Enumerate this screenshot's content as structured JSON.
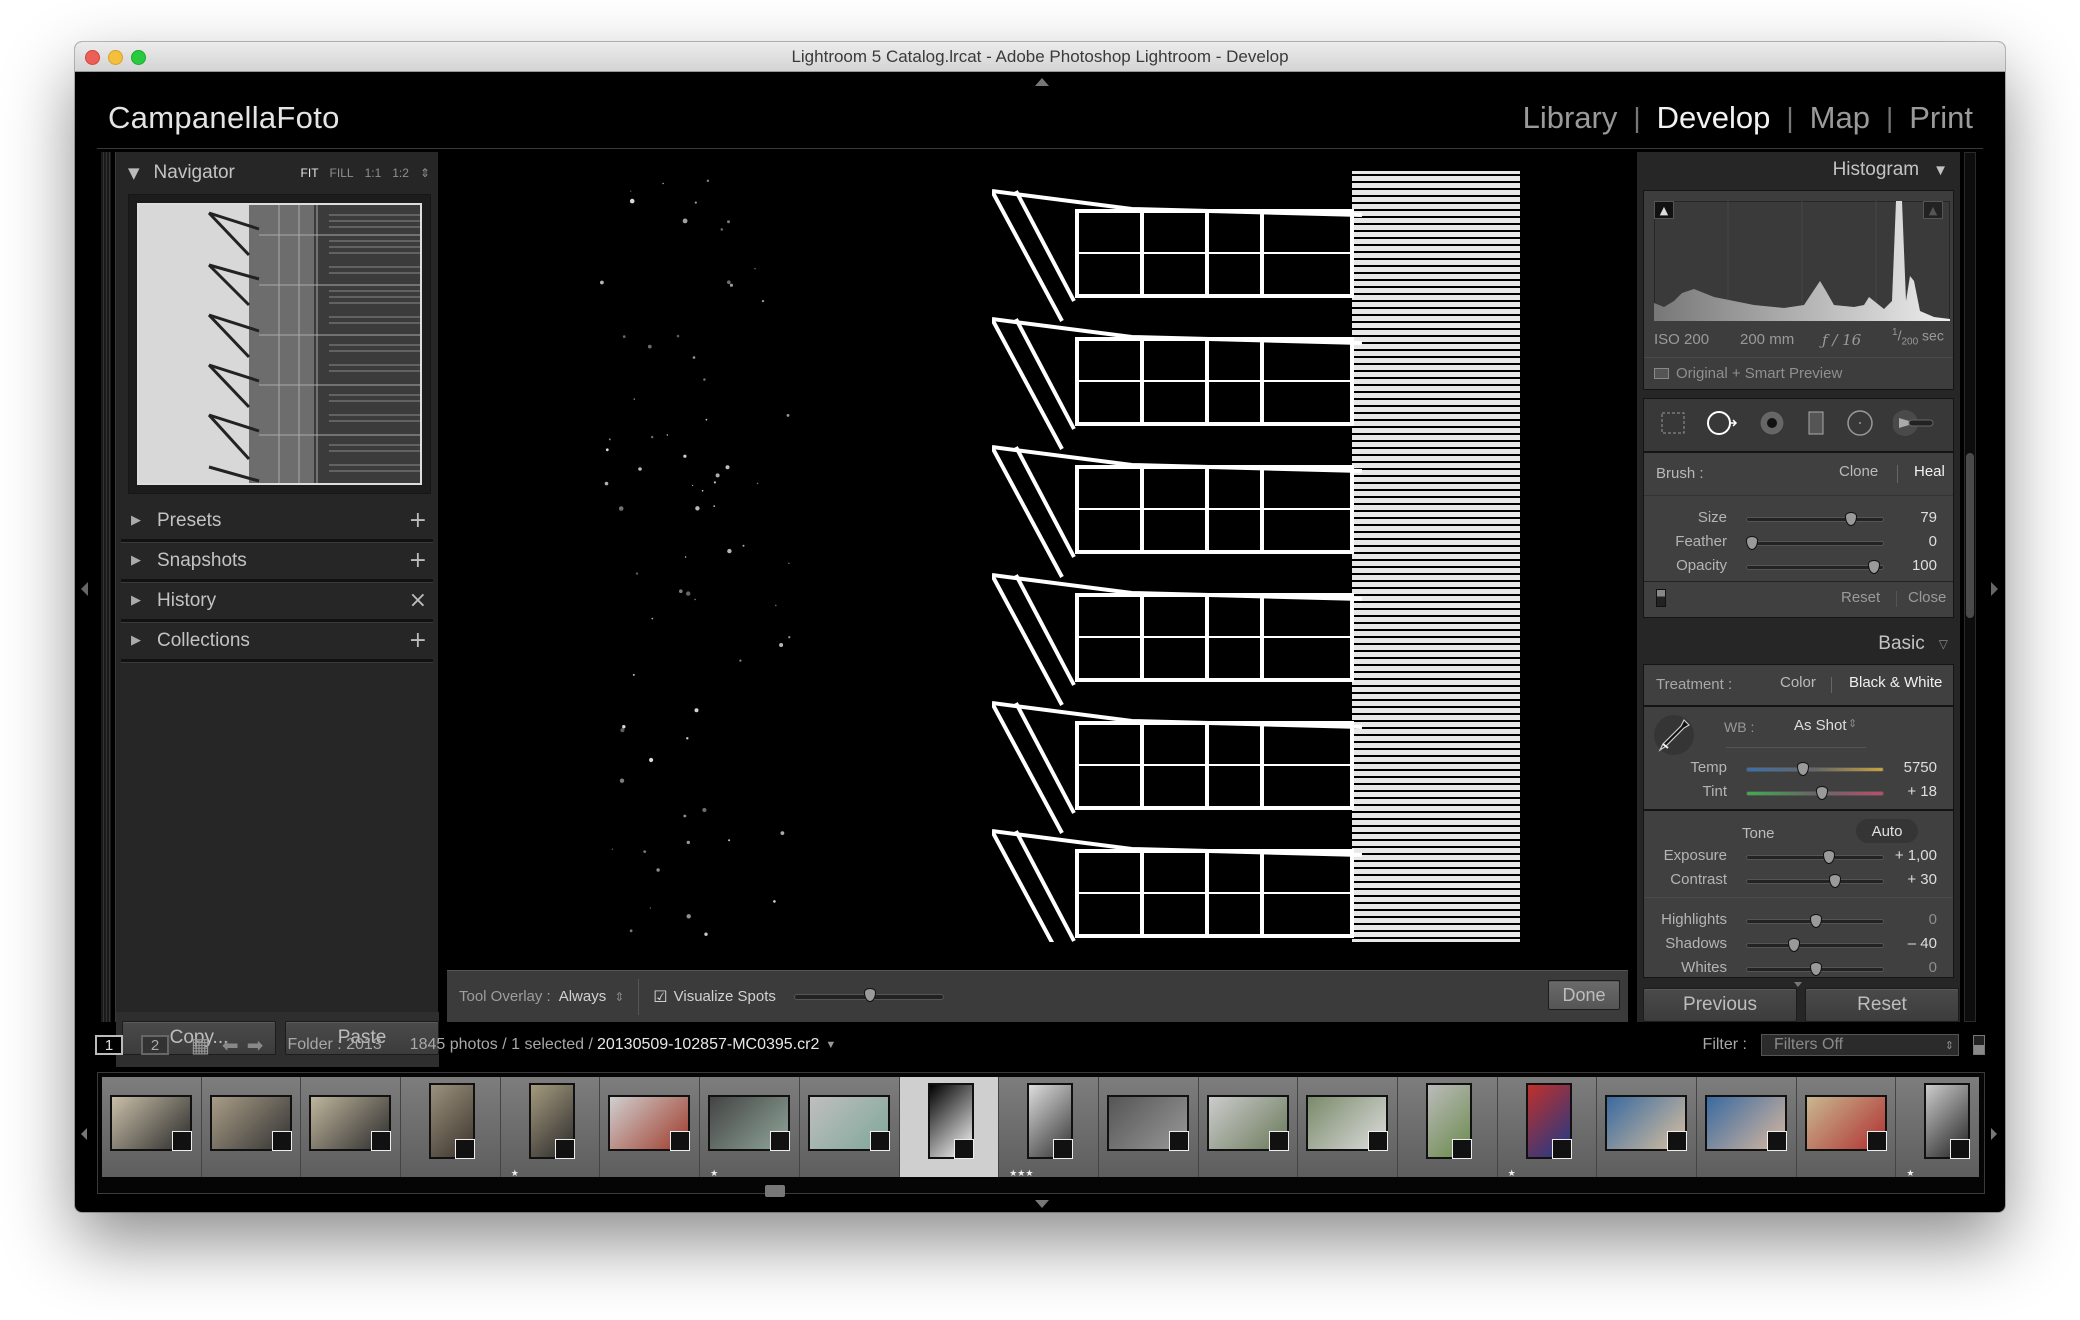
{
  "window": {
    "title": "Lightroom 5 Catalog.lrcat - Adobe Photoshop Lightroom - Develop",
    "traffic_lights": {
      "close": "#ec5f56",
      "minimize": "#f4bf3a",
      "maximize": "#29c940"
    }
  },
  "identity_plate": "CampanellaFoto",
  "modules": [
    {
      "label": "Library",
      "active": false
    },
    {
      "label": "Develop",
      "active": true
    },
    {
      "label": "Map",
      "active": false
    },
    {
      "label": "Print",
      "active": false
    }
  ],
  "left_panel": {
    "navigator": {
      "title": "Navigator",
      "zoom_options": [
        "FIT",
        "FILL",
        "1:1",
        "1:2"
      ],
      "selected_zoom": "FIT"
    },
    "sections": [
      {
        "label": "Presets",
        "action_icon": "plus-icon",
        "action_glyph": "+"
      },
      {
        "label": "Snapshots",
        "action_icon": "plus-icon",
        "action_glyph": "+"
      },
      {
        "label": "History",
        "action_icon": "clear-icon",
        "action_glyph": "×"
      },
      {
        "label": "Collections",
        "action_icon": "plus-menu-icon",
        "action_glyph": "+"
      }
    ],
    "copy_label": "Copy...",
    "paste_label": "Paste"
  },
  "toolbar": {
    "tool_overlay_label": "Tool Overlay :",
    "tool_overlay_value": "Always",
    "visualize_spots_label": "Visualize Spots",
    "visualize_spots_checked": true,
    "visualize_spots_threshold": 0.5,
    "done_label": "Done"
  },
  "right_panel": {
    "histogram": {
      "title": "Histogram",
      "iso": "ISO 200",
      "focal_length": "200 mm",
      "aperture": "ƒ / 16",
      "shutter_num": "1",
      "shutter_den": "200",
      "shutter_unit": "sec",
      "preview_status": "Original + Smart Preview"
    },
    "tools": [
      "crop-overlay-icon",
      "spot-removal-icon",
      "red-eye-icon",
      "graduated-filter-icon",
      "radial-filter-icon",
      "adjustment-brush-icon"
    ],
    "spot_removal": {
      "brush_label": "Brush :",
      "clone_label": "Clone",
      "heal_label": "Heal",
      "active_mode": "Heal",
      "sliders": [
        {
          "label": "Size",
          "value": "79",
          "position": 0.77
        },
        {
          "label": "Feather",
          "value": "0",
          "position": 0.0
        },
        {
          "label": "Opacity",
          "value": "100",
          "position": 0.95
        }
      ],
      "reset_label": "Reset",
      "close_label": "Close"
    },
    "basic": {
      "title": "Basic",
      "treatment_label": "Treatment :",
      "color_label": "Color",
      "bw_label": "Black & White",
      "active_treatment": "Black & White",
      "wb_label": "WB :",
      "wb_value": "As Shot",
      "wb_sliders": [
        {
          "label": "Temp",
          "value": "5750",
          "position": 0.4
        },
        {
          "label": "Tint",
          "value": "+ 18",
          "position": 0.55
        }
      ],
      "tone_label": "Tone",
      "auto_label": "Auto",
      "tone_sliders": [
        {
          "label": "Exposure",
          "value": "+ 1,00",
          "position": 0.6,
          "changed": true
        },
        {
          "label": "Contrast",
          "value": "+ 30",
          "position": 0.65,
          "changed": true
        }
      ],
      "presence_sliders": [
        {
          "label": "Highlights",
          "value": "0",
          "position": 0.5,
          "changed": false
        },
        {
          "label": "Shadows",
          "value": "– 40",
          "position": 0.33,
          "changed": true
        },
        {
          "label": "Whites",
          "value": "0",
          "position": 0.5,
          "changed": false
        }
      ]
    },
    "previous_label": "Previous",
    "reset_label": "Reset"
  },
  "filmstrip_bar": {
    "view1": "1",
    "view2": "2",
    "folder": "Folder : 2013",
    "count": "1845 photos / 1 selected /",
    "filename": "20130509-102857-MC0395.cr2",
    "filter_label": "Filter :",
    "filter_value": "Filters Off"
  },
  "filmstrip": [
    {
      "stars": "",
      "orient": "land",
      "colors": [
        "#c9bfa8",
        "#2a2a2a"
      ]
    },
    {
      "stars": "",
      "orient": "land",
      "colors": [
        "#a89c86",
        "#333"
      ]
    },
    {
      "stars": "",
      "orient": "land",
      "colors": [
        "#bfb59c",
        "#2c2c2c"
      ]
    },
    {
      "stars": "",
      "orient": "port",
      "colors": [
        "#9b917e",
        "#3a332a"
      ]
    },
    {
      "stars": "★",
      "orient": "port",
      "colors": [
        "#a59a7e",
        "#2a2a2a"
      ]
    },
    {
      "stars": "",
      "orient": "land",
      "colors": [
        "#cfcfcf",
        "#a03a2a"
      ]
    },
    {
      "stars": "★",
      "orient": "land",
      "colors": [
        "#444",
        "#8fa69a"
      ]
    },
    {
      "stars": "",
      "orient": "land",
      "colors": [
        "#bfbfbf",
        "#7fa69a"
      ]
    },
    {
      "stars": "",
      "orient": "port",
      "colors": [
        "#000",
        "#fff"
      ],
      "selected": true
    },
    {
      "stars": "★★★",
      "orient": "port",
      "colors": [
        "#ddd",
        "#333"
      ]
    },
    {
      "stars": "",
      "orient": "land",
      "colors": [
        "#555",
        "#999"
      ]
    },
    {
      "stars": "",
      "orient": "land",
      "colors": [
        "#ccc",
        "#6a7a5a"
      ]
    },
    {
      "stars": "",
      "orient": "land",
      "colors": [
        "#7a8a6a",
        "#ddd"
      ]
    },
    {
      "stars": "",
      "orient": "port",
      "colors": [
        "#bbb",
        "#6a8a4a"
      ]
    },
    {
      "stars": "★",
      "orient": "port",
      "colors": [
        "#c0302a",
        "#1a3a8a"
      ]
    },
    {
      "stars": "",
      "orient": "land",
      "colors": [
        "#3a6aa0",
        "#d8c0a0"
      ]
    },
    {
      "stars": "",
      "orient": "land",
      "colors": [
        "#3a6aa0",
        "#d8b8a0"
      ]
    },
    {
      "stars": "",
      "orient": "land",
      "colors": [
        "#c8b890",
        "#b03030"
      ]
    },
    {
      "stars": "★",
      "orient": "port",
      "colors": [
        "#ccc",
        "#222"
      ]
    }
  ]
}
